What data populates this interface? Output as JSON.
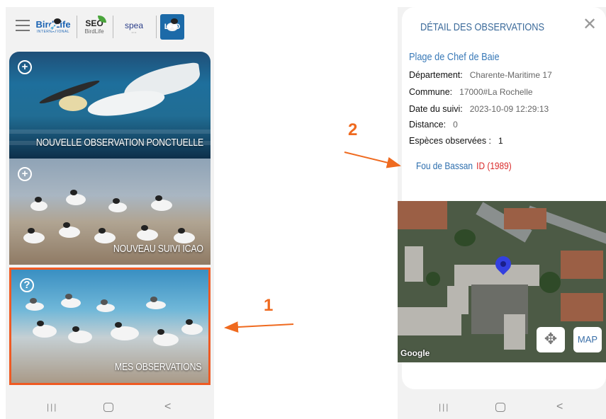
{
  "left_screen": {
    "logos": {
      "birdlife": {
        "name": "BirdLife",
        "sub": "INTERNATIONAL"
      },
      "seo": {
        "name": "SEO",
        "sub": "BirdLife"
      },
      "spea": {
        "name": "spea"
      },
      "lpo": {
        "name": "LPO"
      }
    },
    "cards": [
      {
        "label": "NOUVELLE OBSERVATION PONCTUELLE",
        "icon": "plus-circle-icon"
      },
      {
        "label": "NOUVEAU SUIVI ICAO",
        "icon": "plus-circle-icon"
      },
      {
        "label": "MES OBSERVATIONS",
        "icon": "question-circle-icon",
        "highlighted": true
      }
    ]
  },
  "right_screen": {
    "title": "DÉTAIL DES OBSERVATIONS",
    "place": "Plage de Chef de Baie",
    "fields": [
      {
        "label": "Département:",
        "value": "Charente-Maritime 17"
      },
      {
        "label": "Commune:",
        "value": "17000#La Rochelle"
      },
      {
        "label": "Date du suivi:",
        "value": "2023-10-09 12:29:13"
      },
      {
        "label": "Distance:",
        "value": "0"
      },
      {
        "label": "Espèces observées :",
        "value": "1"
      }
    ],
    "species": {
      "name": "Fou de Bassan",
      "id": "ID (1989)"
    },
    "map": {
      "button": "MAP",
      "attribution": "Google"
    }
  },
  "annotations": {
    "one": "1",
    "two": "2"
  },
  "colors": {
    "annotation": "#ef6a1f",
    "highlight_border": "#ef5a23"
  }
}
